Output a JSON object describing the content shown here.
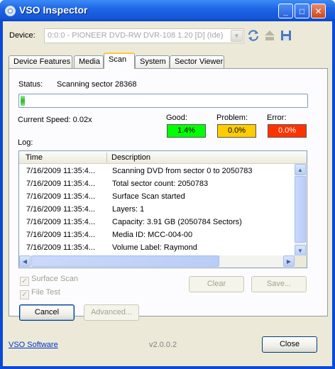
{
  "window": {
    "title": "VSO Inspector",
    "buttons": {
      "minimize": "_",
      "maximize": "□",
      "close": "✕"
    }
  },
  "device": {
    "label": "Device:",
    "value": "0:0:0 - PIONEER DVD-RW  DVR-108 1.20 [D] (Ide)"
  },
  "tabs": [
    {
      "label": "Device Features"
    },
    {
      "label": "Media"
    },
    {
      "label": "Scan"
    },
    {
      "label": "System"
    },
    {
      "label": "Sector Viewer"
    }
  ],
  "scan": {
    "status_label": "Status:",
    "status_value": "Scanning sector 28368",
    "progress_fraction": 0.014,
    "speed_text": "Current Speed: 0.02x",
    "good_label": "Good:",
    "good_value": "1.4%",
    "problem_label": "Problem:",
    "problem_value": "0.0%",
    "error_label": "Error:",
    "error_value": "0.0%",
    "colors": {
      "good": "#00ff00",
      "problem": "#ffcc00",
      "error": "#ff3300"
    },
    "log_label": "Log:",
    "log_columns": [
      "Time",
      "Description"
    ],
    "log_rows": [
      {
        "time": "7/16/2009 11:35:4...",
        "desc": "Scanning DVD from sector 0 to 2050783"
      },
      {
        "time": "7/16/2009 11:35:4...",
        "desc": "Total sector count: 2050783"
      },
      {
        "time": "7/16/2009 11:35:4...",
        "desc": "Surface Scan started"
      },
      {
        "time": "7/16/2009 11:35:4...",
        "desc": "Layers: 1"
      },
      {
        "time": "7/16/2009 11:35:4...",
        "desc": "Capacity: 3.91 GB (2050784 Sectors)"
      },
      {
        "time": "7/16/2009 11:35:4...",
        "desc": "Media ID: MCC-004-00"
      },
      {
        "time": "7/16/2009 11:35:4...",
        "desc": "Volume Label: Raymond"
      }
    ],
    "surface_scan_label": "Surface Scan",
    "file_test_label": "File Test",
    "clear_label": "Clear",
    "save_label": "Save...",
    "cancel_label": "Cancel",
    "advanced_label": "Advanced..."
  },
  "footer": {
    "link": "VSO Software",
    "version": "v2.0.0.2",
    "close_label": "Close"
  }
}
